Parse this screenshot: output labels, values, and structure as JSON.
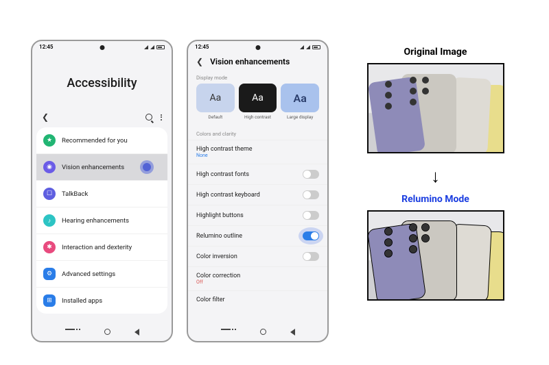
{
  "status": {
    "time": "12:45"
  },
  "screen1": {
    "title": "Accessibility",
    "items": [
      {
        "icon": "star-icon",
        "label": "Recommended for you"
      },
      {
        "icon": "eye-icon",
        "label": "Vision enhancements",
        "selected": true
      },
      {
        "icon": "talk-icon",
        "label": "TalkBack"
      },
      {
        "icon": "ear-icon",
        "label": "Hearing enhancements"
      },
      {
        "icon": "hand-icon",
        "label": "Interaction and dexterity"
      },
      {
        "icon": "gear-icon",
        "label": "Advanced settings"
      },
      {
        "icon": "apps-icon",
        "label": "Installed apps"
      }
    ]
  },
  "screen2": {
    "title": "Vision enhancements",
    "section_display": "Display mode",
    "modes": [
      {
        "sample": "Aa",
        "label": "Default"
      },
      {
        "sample": "Aa",
        "label": "High contrast"
      },
      {
        "sample": "Aa",
        "label": "Large display"
      }
    ],
    "section_colors": "Colors and clarity",
    "items": [
      {
        "label": "High contrast theme",
        "sub": "None",
        "sub_color": "blue"
      },
      {
        "label": "High contrast fonts",
        "toggle": false
      },
      {
        "label": "High contrast keyboard",
        "toggle": false
      },
      {
        "label": "Highlight buttons",
        "toggle": false
      },
      {
        "label": "Relumino outline",
        "toggle": true,
        "glow": true
      },
      {
        "label": "Color inversion",
        "toggle": false
      },
      {
        "label": "Color correction",
        "sub": "Off",
        "sub_color": "red"
      },
      {
        "label": "Color filter"
      }
    ]
  },
  "right": {
    "original_title": "Original Image",
    "mode_title": "Relumino Mode"
  }
}
